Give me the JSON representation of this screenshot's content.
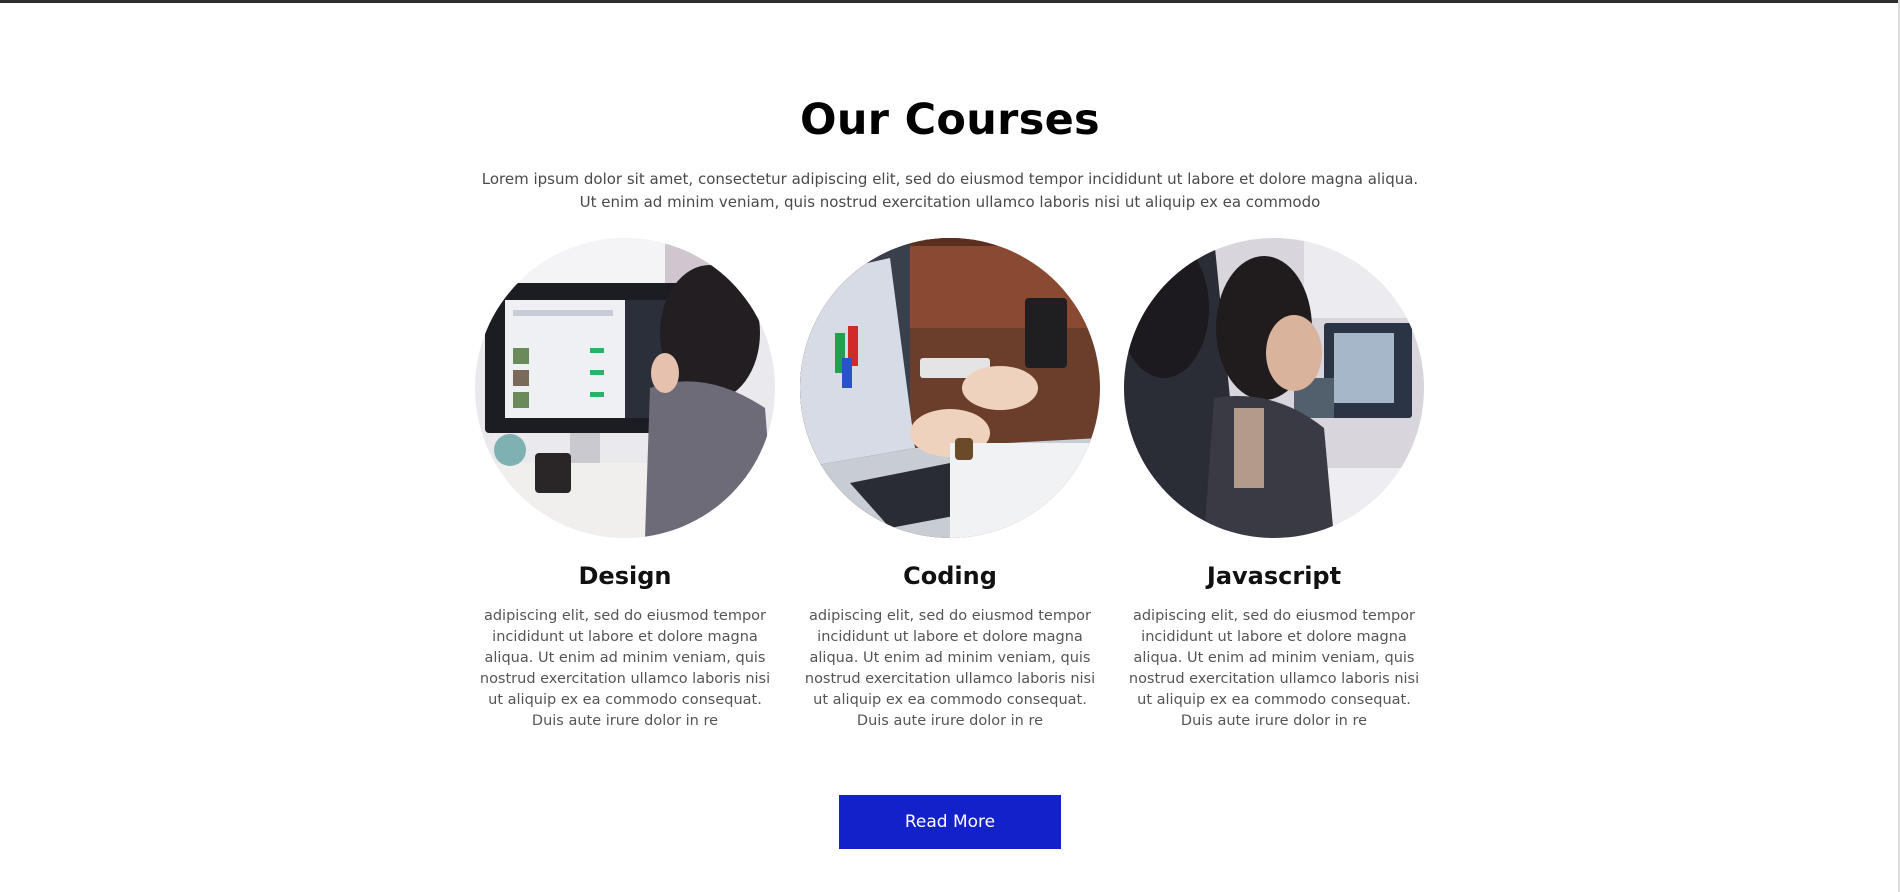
{
  "section": {
    "title": "Our Courses",
    "intro": "Lorem ipsum dolor sit amet, consectetur adipiscing elit, sed do eiusmod tempor incididunt ut labore et dolore magna aliqua. Ut enim ad minim veniam, quis nostrud exercitation ullamco laboris nisi ut aliquip ex ea commodo"
  },
  "courses": [
    {
      "title": "Design",
      "description": "adipiscing elit, sed do eiusmod tempor incididunt ut labore et dolore magna aliqua. Ut enim ad minim veniam, quis nostrud exercitation ullamco laboris nisi ut aliquip ex ea commodo consequat. Duis aute irure dolor in re",
      "image": "woman-at-desktop-monitor-photo"
    },
    {
      "title": "Coding",
      "description": "adipiscing elit, sed do eiusmod tempor incididunt ut labore et dolore magna aliqua. Ut enim ad minim veniam, quis nostrud exercitation ullamco laboris nisi ut aliquip ex ea commodo consequat. Duis aute irure dolor in re",
      "image": "hands-typing-on-laptop-photo"
    },
    {
      "title": "Javascript",
      "description": "adipiscing elit, sed do eiusmod tempor incididunt ut labore et dolore magna aliqua. Ut enim ad minim veniam, quis nostrud exercitation ullamco laboris nisi ut aliquip ex ea commodo consequat. Duis aute irure dolor in re",
      "image": "women-working-at-computers-photo"
    }
  ],
  "button": {
    "label": "Read More",
    "color": "#1221c9"
  }
}
